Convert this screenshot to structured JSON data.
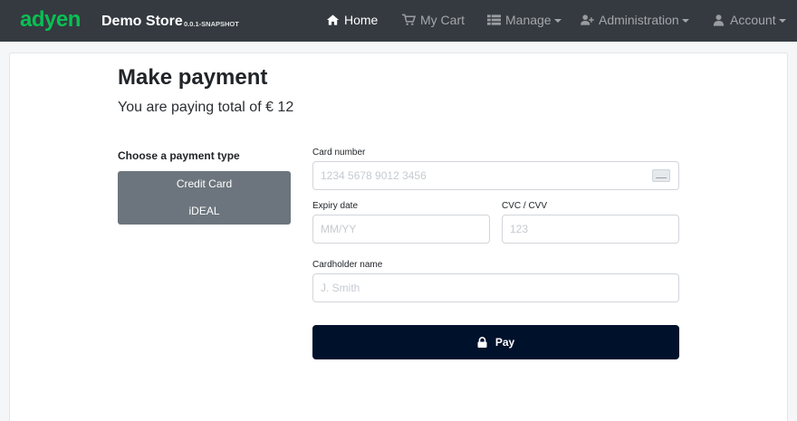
{
  "navbar": {
    "logo_text": "adyen",
    "brand": "Demo Store",
    "version": "0.0.1-SNAPSHOT",
    "items": [
      {
        "label": "Home",
        "icon": "home-icon",
        "active": true
      },
      {
        "label": "My Cart",
        "icon": "cart-icon"
      },
      {
        "label": "Manage",
        "icon": "list-icon",
        "dropdown": true
      },
      {
        "label": "Administration",
        "icon": "user-plus-icon",
        "dropdown": true
      },
      {
        "label": "Account",
        "icon": "user-icon",
        "dropdown": true
      }
    ]
  },
  "page": {
    "title": "Make payment",
    "subtitle": "You are paying total of € 12"
  },
  "payment_types": {
    "label": "Choose a payment type",
    "options": [
      "Credit Card",
      "iDEAL"
    ]
  },
  "form": {
    "card_number": {
      "label": "Card number",
      "placeholder": "1234 5678 9012 3456"
    },
    "expiry": {
      "label": "Expiry date",
      "placeholder": "MM/YY"
    },
    "cvc": {
      "label": "CVC / CVV",
      "placeholder": "123"
    },
    "holder": {
      "label": "Cardholder name",
      "placeholder": "J. Smith"
    },
    "pay_label": "Pay"
  },
  "colors": {
    "navbar": "#343a40",
    "logo": "#0abf53",
    "pay_button": "#00112c",
    "payment_type_bg": "#6c757d"
  }
}
